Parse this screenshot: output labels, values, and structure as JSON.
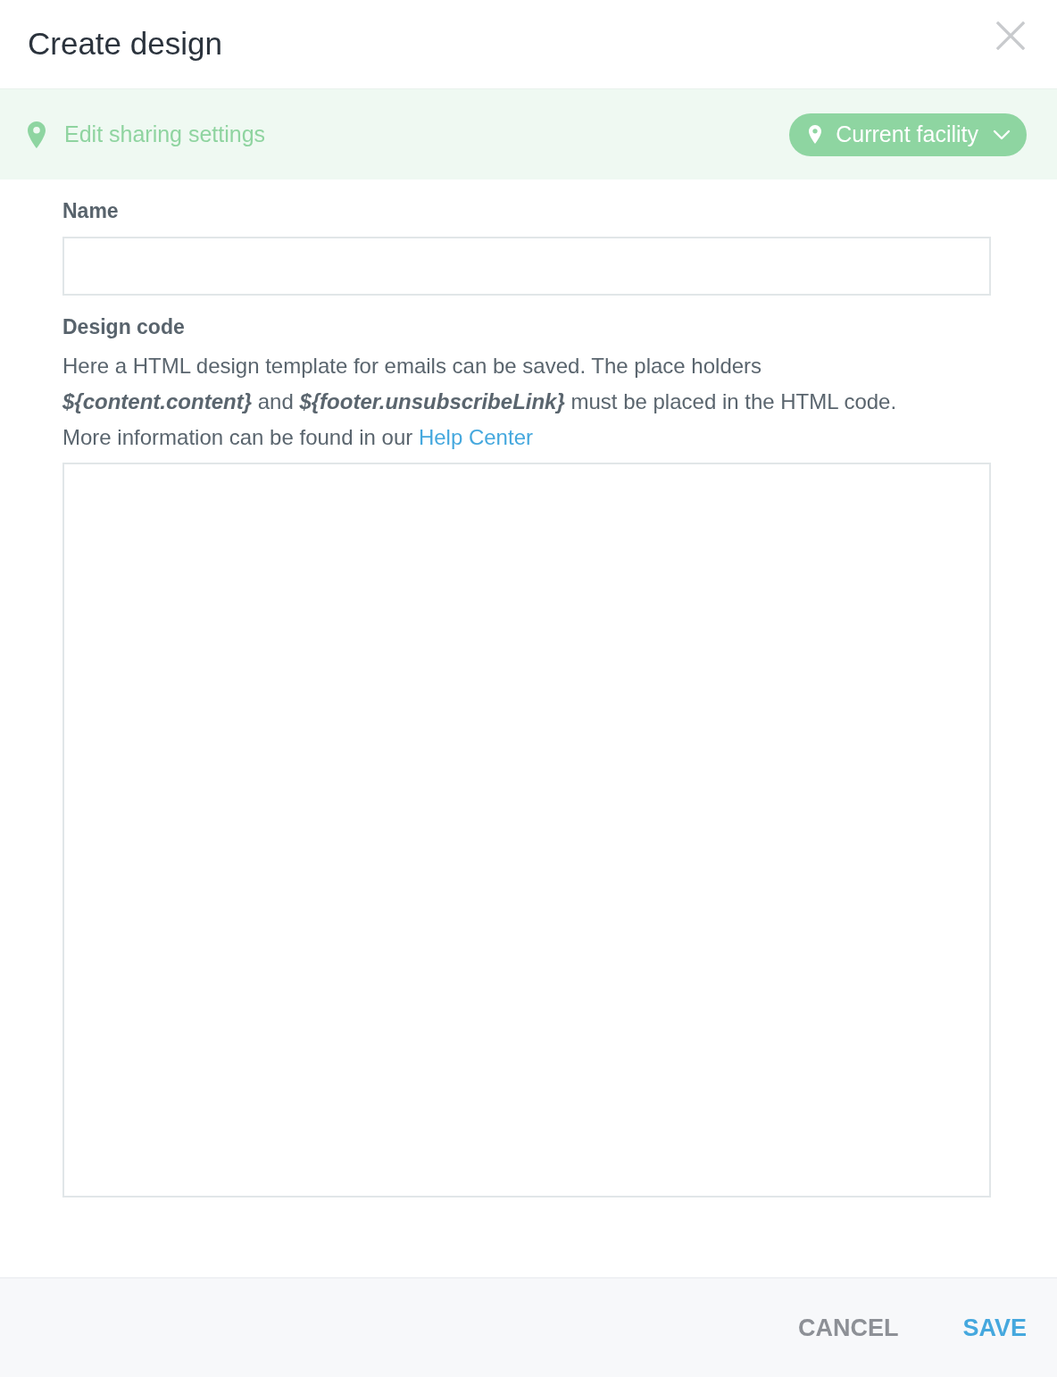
{
  "dialog": {
    "title": "Create design"
  },
  "sharing": {
    "label": "Edit sharing settings",
    "scope": "Current facility"
  },
  "form": {
    "name": {
      "label": "Name"
    },
    "design_code": {
      "label": "Design code",
      "description": "Here a HTML design template for emails can be saved. The place holders **${content.content}** and **${footer.unsubscribeLink}** must be placed in the HTML code. More information can be found in our",
      "link": "Help Center"
    }
  },
  "buttons": [
    {
      "label": "CANCEL",
      "kind": "secondary"
    },
    {
      "label": "SAVE",
      "kind": "primary"
    }
  ]
}
